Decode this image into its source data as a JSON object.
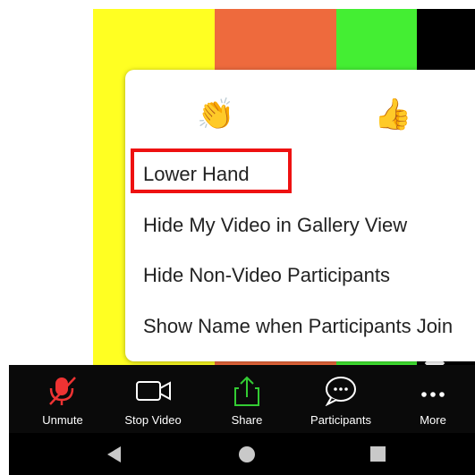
{
  "reactions": {
    "clap": "👏",
    "thumbs_up": "👍"
  },
  "menu": {
    "items": [
      {
        "label": "Lower Hand"
      },
      {
        "label": "Hide My Video in Gallery View"
      },
      {
        "label": "Hide Non-Video Participants"
      },
      {
        "label": "Show Name when Participants Join"
      }
    ],
    "highlight_color": "#ee1111"
  },
  "toolbar": {
    "unmute_label": "Unmute",
    "stop_video_label": "Stop Video",
    "share_label": "Share",
    "participants_label": "Participants",
    "more_label": "More",
    "unmute_icon": "microphone-muted-icon",
    "stop_video_icon": "video-camera-icon",
    "share_icon": "share-upload-icon",
    "participants_icon": "chat-bubble-icon",
    "more_icon": "more-dots-icon",
    "unmute_color": "#ee3333",
    "share_color": "#33cc33"
  },
  "navbar": {
    "back_icon": "back-triangle-icon",
    "home_icon": "home-circle-icon",
    "recent_icon": "recent-square-icon"
  }
}
